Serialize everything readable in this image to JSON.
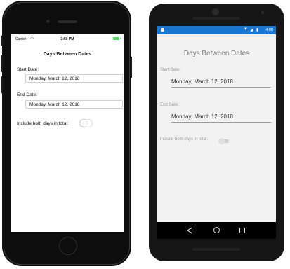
{
  "ios": {
    "status": {
      "carrier": "Carrier",
      "wifi_icon": "wifi-icon",
      "time": "3:58 PM",
      "battery_icon": "battery-icon",
      "battery_color": "#4cd964"
    },
    "title": "Days Between Dates",
    "start_label": "Start Date:",
    "start_value": "Monday, March 12, 2018",
    "end_label": "End Date:",
    "end_value": "Monday, March 12, 2018",
    "include_label": "Include both days in total:",
    "include_on": false
  },
  "android": {
    "status": {
      "time": "4:00",
      "status_bar_color": "#1976d2"
    },
    "title": "Days Between Dates",
    "start_label": "Start Date:",
    "start_value": "Monday, March 12, 2018",
    "end_label": "End Date:",
    "end_value": "Monday, March 12, 2018",
    "include_label": "Include both days in total:",
    "include_on": false,
    "nav": {
      "back_icon": "back-triangle-icon",
      "home_icon": "home-circle-icon",
      "recent_icon": "recent-apps-square-icon"
    }
  }
}
